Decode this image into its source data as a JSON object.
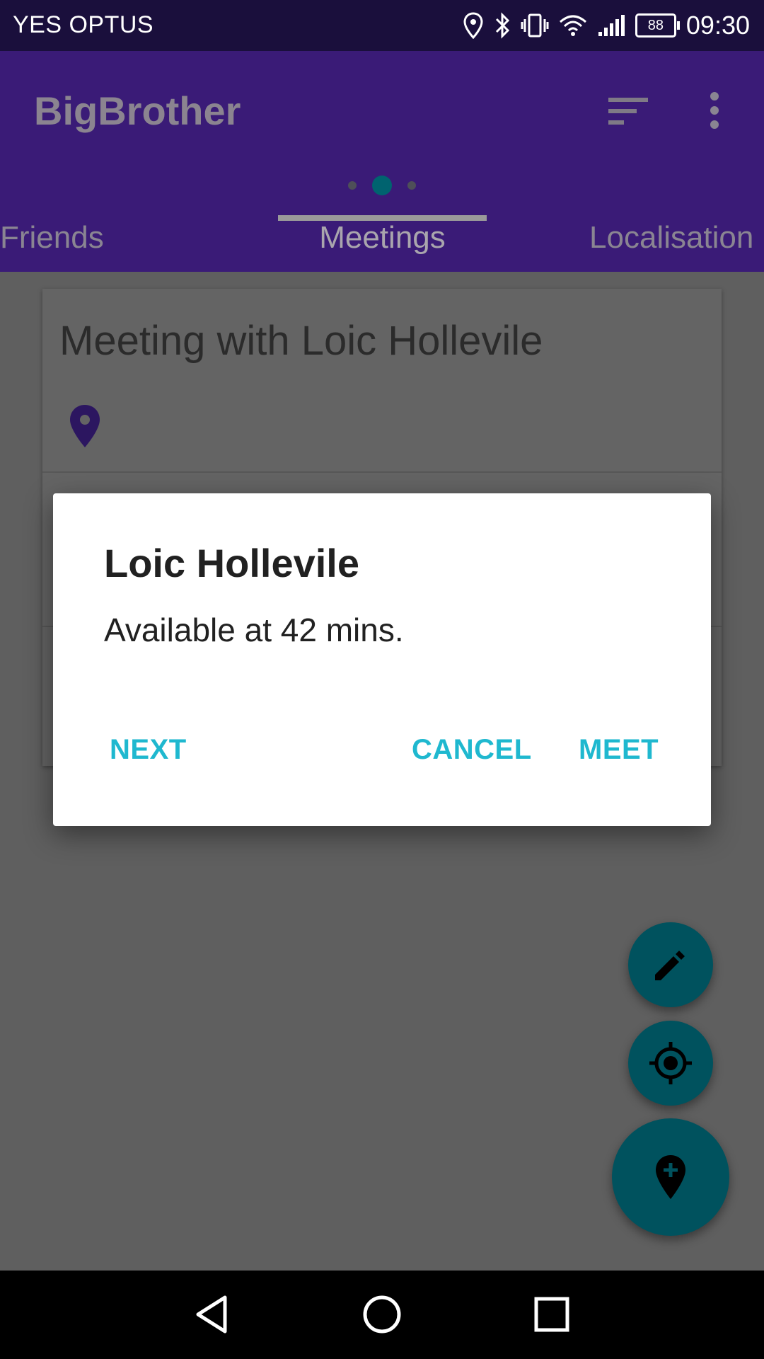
{
  "status_bar": {
    "carrier": "YES OPTUS",
    "battery": "88",
    "time": "09:30",
    "icons": [
      "location-icon",
      "bluetooth-icon",
      "vibrate-icon",
      "wifi-icon",
      "signal-icon",
      "battery-icon"
    ]
  },
  "app_bar": {
    "title": "BigBrother",
    "actions": [
      "sort-icon",
      "more-options-icon"
    ],
    "pager": {
      "count": 3,
      "active_index": 1
    }
  },
  "tabs": [
    {
      "label": "Friends"
    },
    {
      "label": "Meetings",
      "selected": true
    },
    {
      "label": "Localisation"
    }
  ],
  "card": {
    "title": "Meeting with Loic Hollevile",
    "icon": "map-pin-icon"
  },
  "dialog": {
    "title": "Loic Hollevile",
    "message": "Available at 42 mins.",
    "buttons": {
      "next": "NEXT",
      "cancel": "CANCEL",
      "meet": "MEET"
    }
  },
  "fabs": [
    "edit-icon",
    "crosshair-icon",
    "add-location-icon"
  ],
  "nav_bar": [
    "back-icon",
    "home-icon",
    "recents-icon"
  ],
  "colors": {
    "status_bar": "#1a0f3c",
    "app_bar": "#3a1b77",
    "accent": "#1fb8cf",
    "fab": "#00525e",
    "pin": "#3a1b77"
  }
}
